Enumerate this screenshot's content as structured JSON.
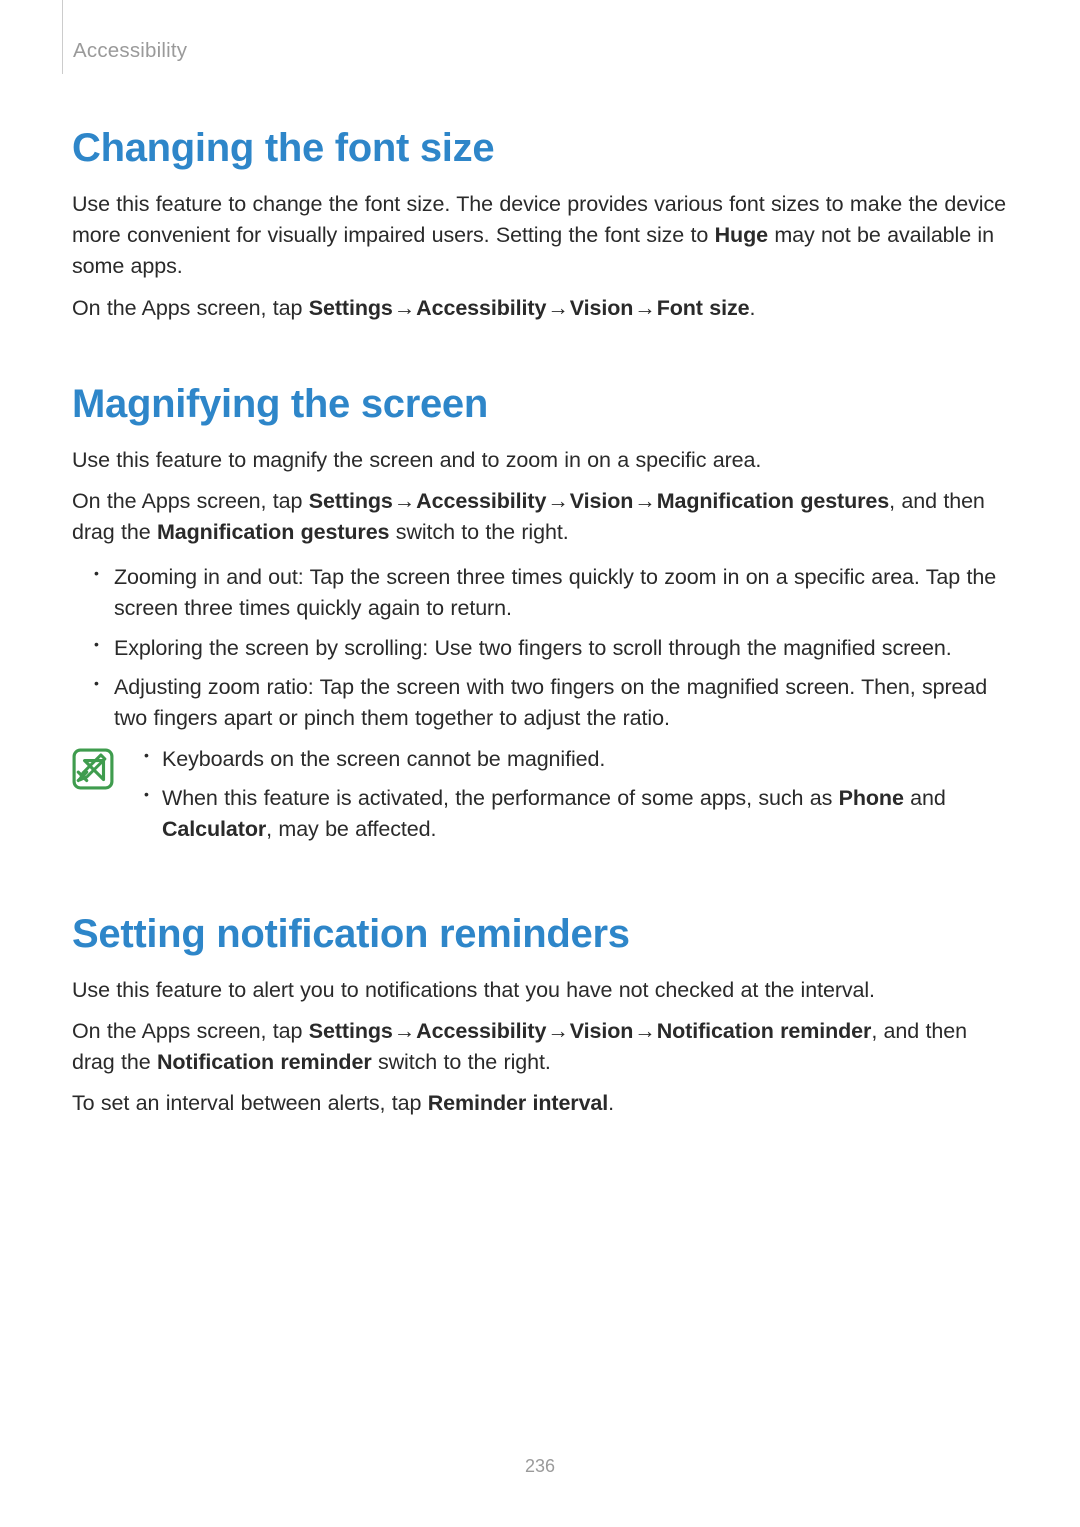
{
  "header": {
    "category": "Accessibility"
  },
  "page_number": "236",
  "arrow": "→",
  "sections": {
    "font": {
      "title": "Changing the font size",
      "p1a": "Use this feature to change the font size. The device provides various font sizes to make the device more convenient for visually impaired users. Setting the font size to ",
      "p1b_bold": "Huge",
      "p1c": " may not be available in some apps.",
      "p2a": "On the Apps screen, tap ",
      "path": [
        "Settings",
        "Accessibility",
        "Vision",
        "Font size"
      ],
      "p2b": "."
    },
    "magnify": {
      "title": "Magnifying the screen",
      "p1": "Use this feature to magnify the screen and to zoom in on a specific area.",
      "p2a": "On the Apps screen, tap ",
      "path": [
        "Settings",
        "Accessibility",
        "Vision",
        "Magnification gestures"
      ],
      "p2b": ", and then drag the ",
      "p2c_bold": "Magnification gestures",
      "p2d": " switch to the right.",
      "bullets": [
        "Zooming in and out: Tap the screen three times quickly to zoom in on a specific area. Tap the screen three times quickly again to return.",
        "Exploring the screen by scrolling: Use two fingers to scroll through the magnified screen.",
        "Adjusting zoom ratio: Tap the screen with two fingers on the magnified screen. Then, spread two fingers apart or pinch them together to adjust the ratio."
      ],
      "note": {
        "b1": "Keyboards on the screen cannot be magnified.",
        "b2a": "When this feature is activated, the performance of some apps, such as ",
        "b2b_bold": "Phone",
        "b2c": " and ",
        "b2d_bold": "Calculator",
        "b2e": ", may be affected."
      }
    },
    "notify": {
      "title": "Setting notification reminders",
      "p1": "Use this feature to alert you to notifications that you have not checked at the interval.",
      "p2a": "On the Apps screen, tap ",
      "path": [
        "Settings",
        "Accessibility",
        "Vision",
        "Notification reminder"
      ],
      "p2b": ", and then drag the ",
      "p2c_bold": "Notification reminder",
      "p2d": " switch to the right.",
      "p3a": "To set an interval between alerts, tap ",
      "p3b_bold": "Reminder interval",
      "p3c": "."
    }
  }
}
